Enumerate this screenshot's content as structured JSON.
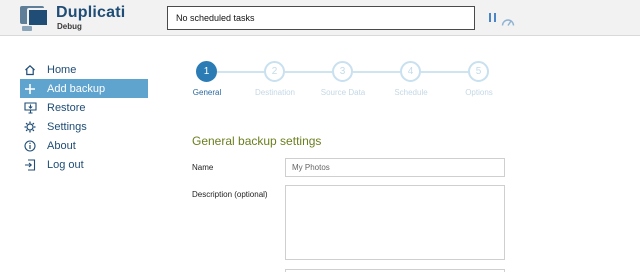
{
  "app": {
    "title": "Duplicati",
    "subtitle": "Debug"
  },
  "status": {
    "text": "No scheduled tasks"
  },
  "header_icons": [
    "pause-icon",
    "throttle-icon"
  ],
  "sidebar": {
    "items": [
      {
        "label": "Home",
        "icon": "home-icon",
        "active": false
      },
      {
        "label": "Add backup",
        "icon": "plus-icon",
        "active": true
      },
      {
        "label": "Restore",
        "icon": "restore-icon",
        "active": false
      },
      {
        "label": "Settings",
        "icon": "gear-icon",
        "active": false
      },
      {
        "label": "About",
        "icon": "info-icon",
        "active": false
      },
      {
        "label": "Log out",
        "icon": "logout-icon",
        "active": false
      }
    ]
  },
  "stepper": {
    "steps": [
      {
        "number": "1",
        "label": "General",
        "active": true
      },
      {
        "number": "2",
        "label": "Destination",
        "active": false
      },
      {
        "number": "3",
        "label": "Source Data",
        "active": false
      },
      {
        "number": "4",
        "label": "Schedule",
        "active": false
      },
      {
        "number": "5",
        "label": "Options",
        "active": false
      }
    ]
  },
  "form": {
    "section_title": "General backup settings",
    "name_label": "Name",
    "name_value": "My Photos",
    "description_label": "Description (optional)",
    "description_value": ""
  },
  "colors": {
    "brand": "#1f4d76",
    "active_nav": "#5fa3cf",
    "step_active": "#2b7cb5",
    "section_title": "#6a7f1e"
  }
}
